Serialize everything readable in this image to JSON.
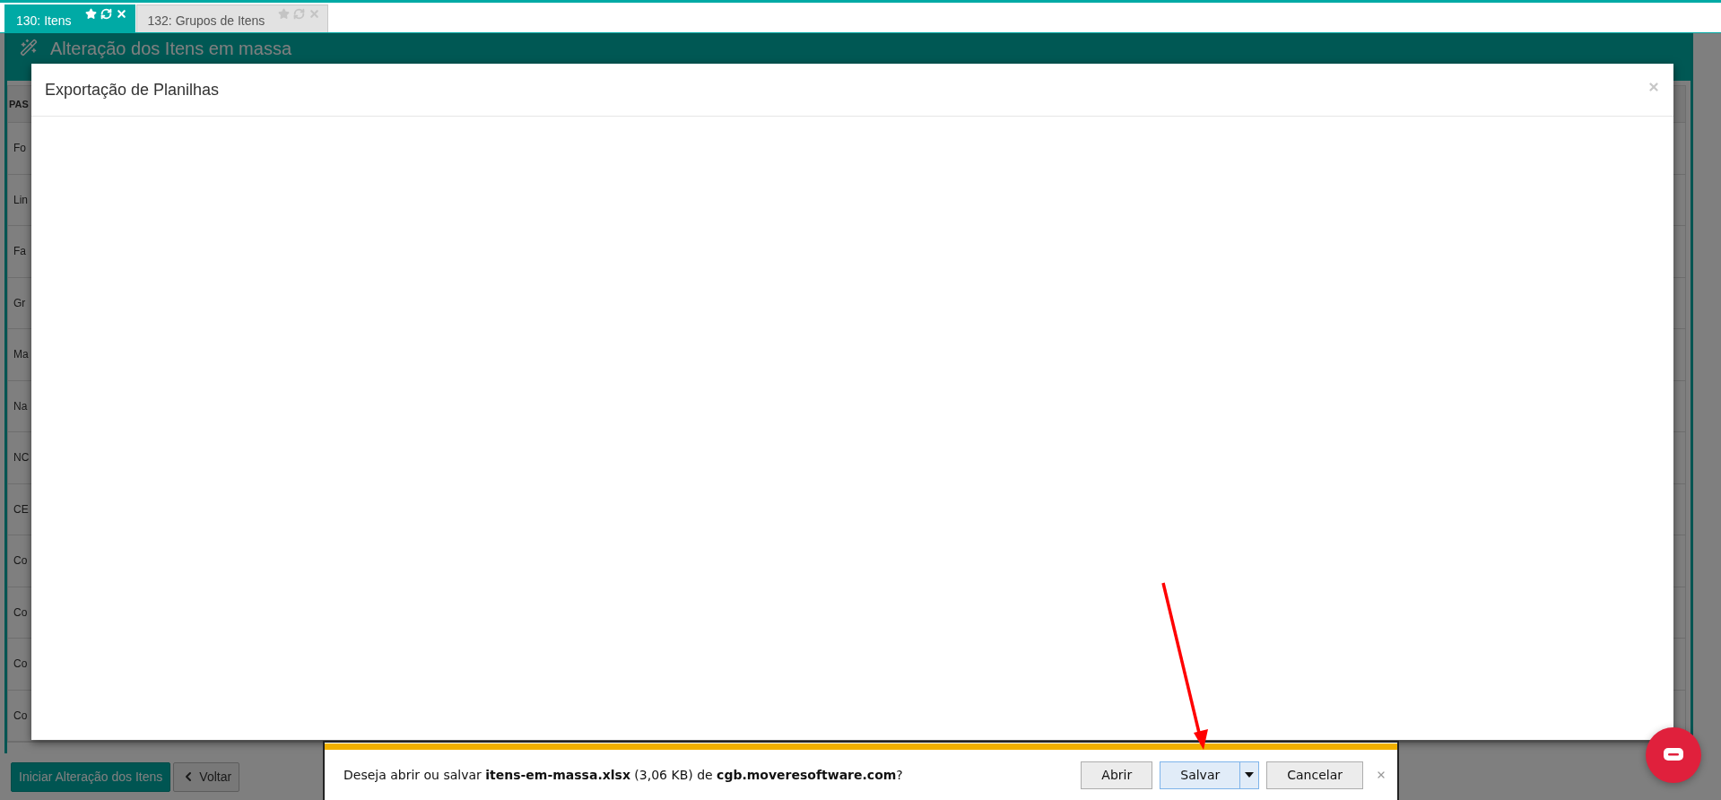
{
  "tabs": [
    {
      "label": "130: Itens",
      "selected": true
    },
    {
      "label": "132: Grupos de Itens",
      "selected": false
    }
  ],
  "page": {
    "title": "Alteração dos Itens em massa",
    "column_header": "PAS",
    "rows": [
      "Fo",
      "Lin",
      "Fa",
      "Gr",
      "Ma",
      "Na",
      "NC",
      "CE",
      "Co",
      "Co",
      "Co",
      "Co"
    ]
  },
  "footer_buttons": [
    {
      "label": "Iniciar Alteração dos Itens",
      "kind": "primary"
    },
    {
      "label": "Voltar",
      "kind": "back"
    }
  ],
  "modal": {
    "title": "Exportação de Planilhas"
  },
  "download_bar": {
    "message": "Deseja abrir ou salvar **itens-em-massa.xlsx** (3,06 KB) de **cgb.moveresoftware.com**?",
    "buttons": [
      {
        "label": "Abrir",
        "kind": "plain",
        "selected": false
      },
      {
        "label": "Salvar",
        "kind": "split",
        "selected": true
      },
      {
        "label": "Cancelar",
        "kind": "plain",
        "selected": false
      }
    ]
  }
}
